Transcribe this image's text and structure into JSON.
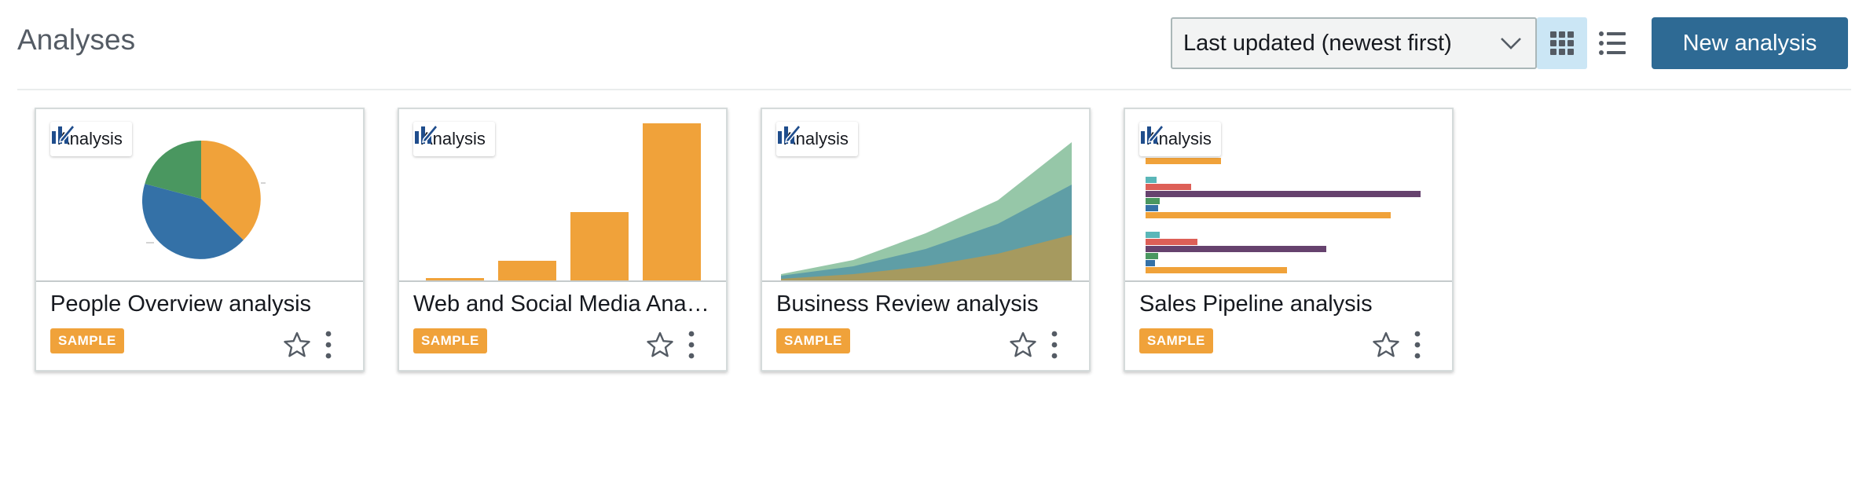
{
  "header": {
    "title": "Analyses",
    "sort": {
      "selected": "Last updated (newest first)"
    },
    "view_toggle": {
      "grid_icon": "grid-view-icon",
      "list_icon": "list-view-icon",
      "active": "grid"
    },
    "new_button_label": "New analysis"
  },
  "cards": [
    {
      "type_label": "Analysis",
      "title": "People Overview analysis",
      "badge": "SAMPLE",
      "thumbnail": "pie-chart",
      "favorited": false
    },
    {
      "type_label": "Analysis",
      "title": "Web and Social Media Analysis",
      "badge": "SAMPLE",
      "thumbnail": "bar-chart",
      "favorited": false
    },
    {
      "type_label": "Analysis",
      "title": "Business Review analysis",
      "badge": "SAMPLE",
      "thumbnail": "stacked-area-chart",
      "favorited": false
    },
    {
      "type_label": "Analysis",
      "title": "Sales Pipeline analysis",
      "badge": "SAMPLE",
      "thumbnail": "horizontal-bar-chart",
      "favorited": false
    }
  ],
  "colors": {
    "primary": "#2e6a94",
    "sample_badge": "#f0a23a",
    "orange": "#f0a23a",
    "blue": "#3471a7",
    "green": "#4a9760",
    "teal": "#5ab6b8",
    "red": "#dd5f57",
    "purple": "#66426e",
    "analysis_icon": "#1f4d8c"
  }
}
